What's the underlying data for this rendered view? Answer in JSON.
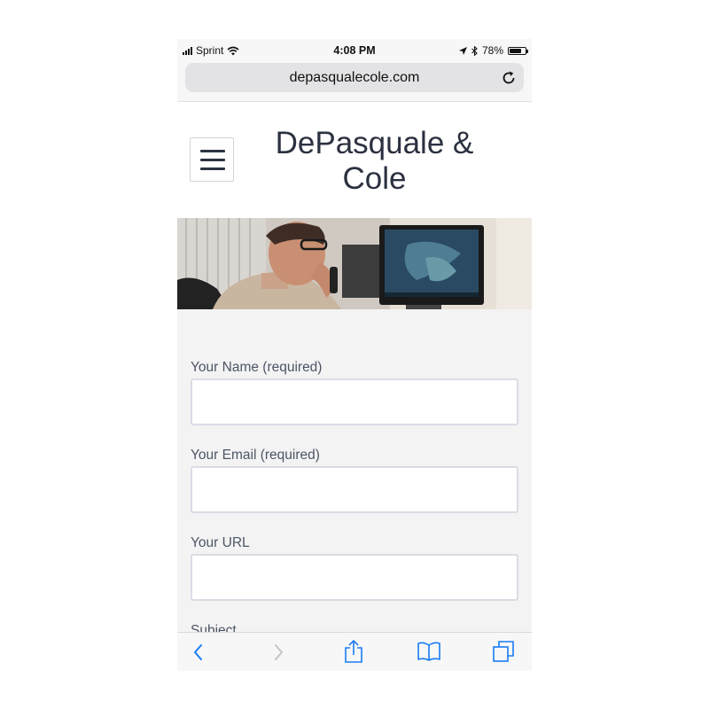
{
  "status_bar": {
    "carrier": "Sprint",
    "time": "4:08 PM",
    "battery_percent": "78%",
    "battery_level": 0.78,
    "icons": [
      "signal-bars-icon",
      "wifi-icon",
      "location-arrow-icon",
      "bluetooth-icon",
      "battery-icon"
    ]
  },
  "browser": {
    "url": "depasqualecole.com",
    "icons": [
      "reload-icon"
    ]
  },
  "site": {
    "title_line1": "DePasquale &",
    "title_line2": "Cole",
    "menu_icon": "hamburger-menu-icon"
  },
  "form": {
    "fields": [
      {
        "label": "Your Name (required)",
        "value": "",
        "placeholder": ""
      },
      {
        "label": "Your Email (required)",
        "value": "",
        "placeholder": ""
      },
      {
        "label": "Your URL",
        "value": "",
        "placeholder": ""
      },
      {
        "label": "Subject"
      }
    ]
  },
  "toolbar": {
    "icons": [
      "back-chevron-icon",
      "forward-chevron-icon",
      "share-icon",
      "bookmarks-book-icon",
      "tabs-icon"
    ],
    "accent_color": "#1a7cf5",
    "disabled_color": "#c4c4c6"
  },
  "colors": {
    "title_text": "#2b3140",
    "label_text": "#4c5566",
    "form_background": "#f3f3f3"
  }
}
